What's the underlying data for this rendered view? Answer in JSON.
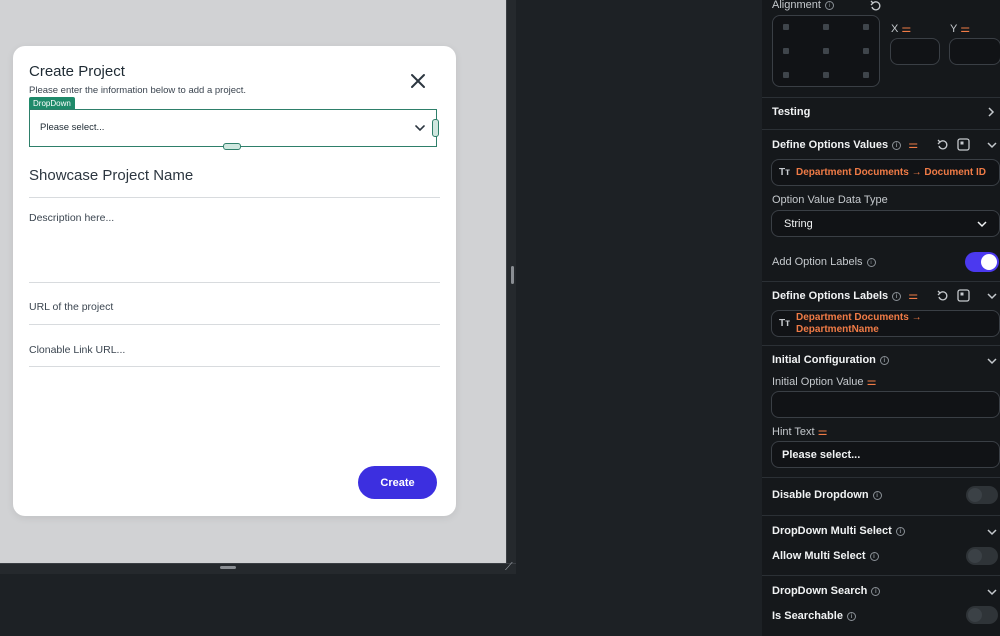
{
  "modal": {
    "title": "Create Project",
    "subtitle": "Please enter the information below to add a project.",
    "dropdown_tag": "DropDown",
    "dropdown_placeholder": "Please select...",
    "name_placeholder": "Showcase Project Name",
    "description_placeholder": "Description here...",
    "url_placeholder": "URL of the project",
    "clone_placeholder": "Clonable Link URL...",
    "create_label": "Create"
  },
  "panel": {
    "alignment_label": "Alignment",
    "x_label": "X",
    "y_label": "Y",
    "testing_label": "Testing",
    "define_options_values_label": "Define Options Values",
    "options_values_source": "Department Documents → Document ID",
    "option_value_data_type_label": "Option Value Data Type",
    "option_value_data_type_value": "String",
    "add_option_labels_label": "Add Option Labels",
    "add_option_labels_on": true,
    "define_options_labels_label": "Define Options Labels",
    "options_labels_source_line1": "Department Documents →",
    "options_labels_source_line2": "DepartmentName",
    "initial_configuration_label": "Initial Configuration",
    "initial_option_value_label": "Initial Option Value",
    "initial_option_value": "",
    "hint_text_label": "Hint Text",
    "hint_text_value": "Please select...",
    "disable_dropdown_label": "Disable Dropdown",
    "multi_select_heading": "DropDown Multi Select",
    "allow_multi_select_label": "Allow Multi Select",
    "search_heading": "DropDown Search",
    "is_searchable_label": "Is Searchable"
  },
  "colors": {
    "accent": "#4b39ef",
    "create_button": "#3c2fe0",
    "source_text": "#f07b46",
    "selection": "#2e7f6a"
  }
}
